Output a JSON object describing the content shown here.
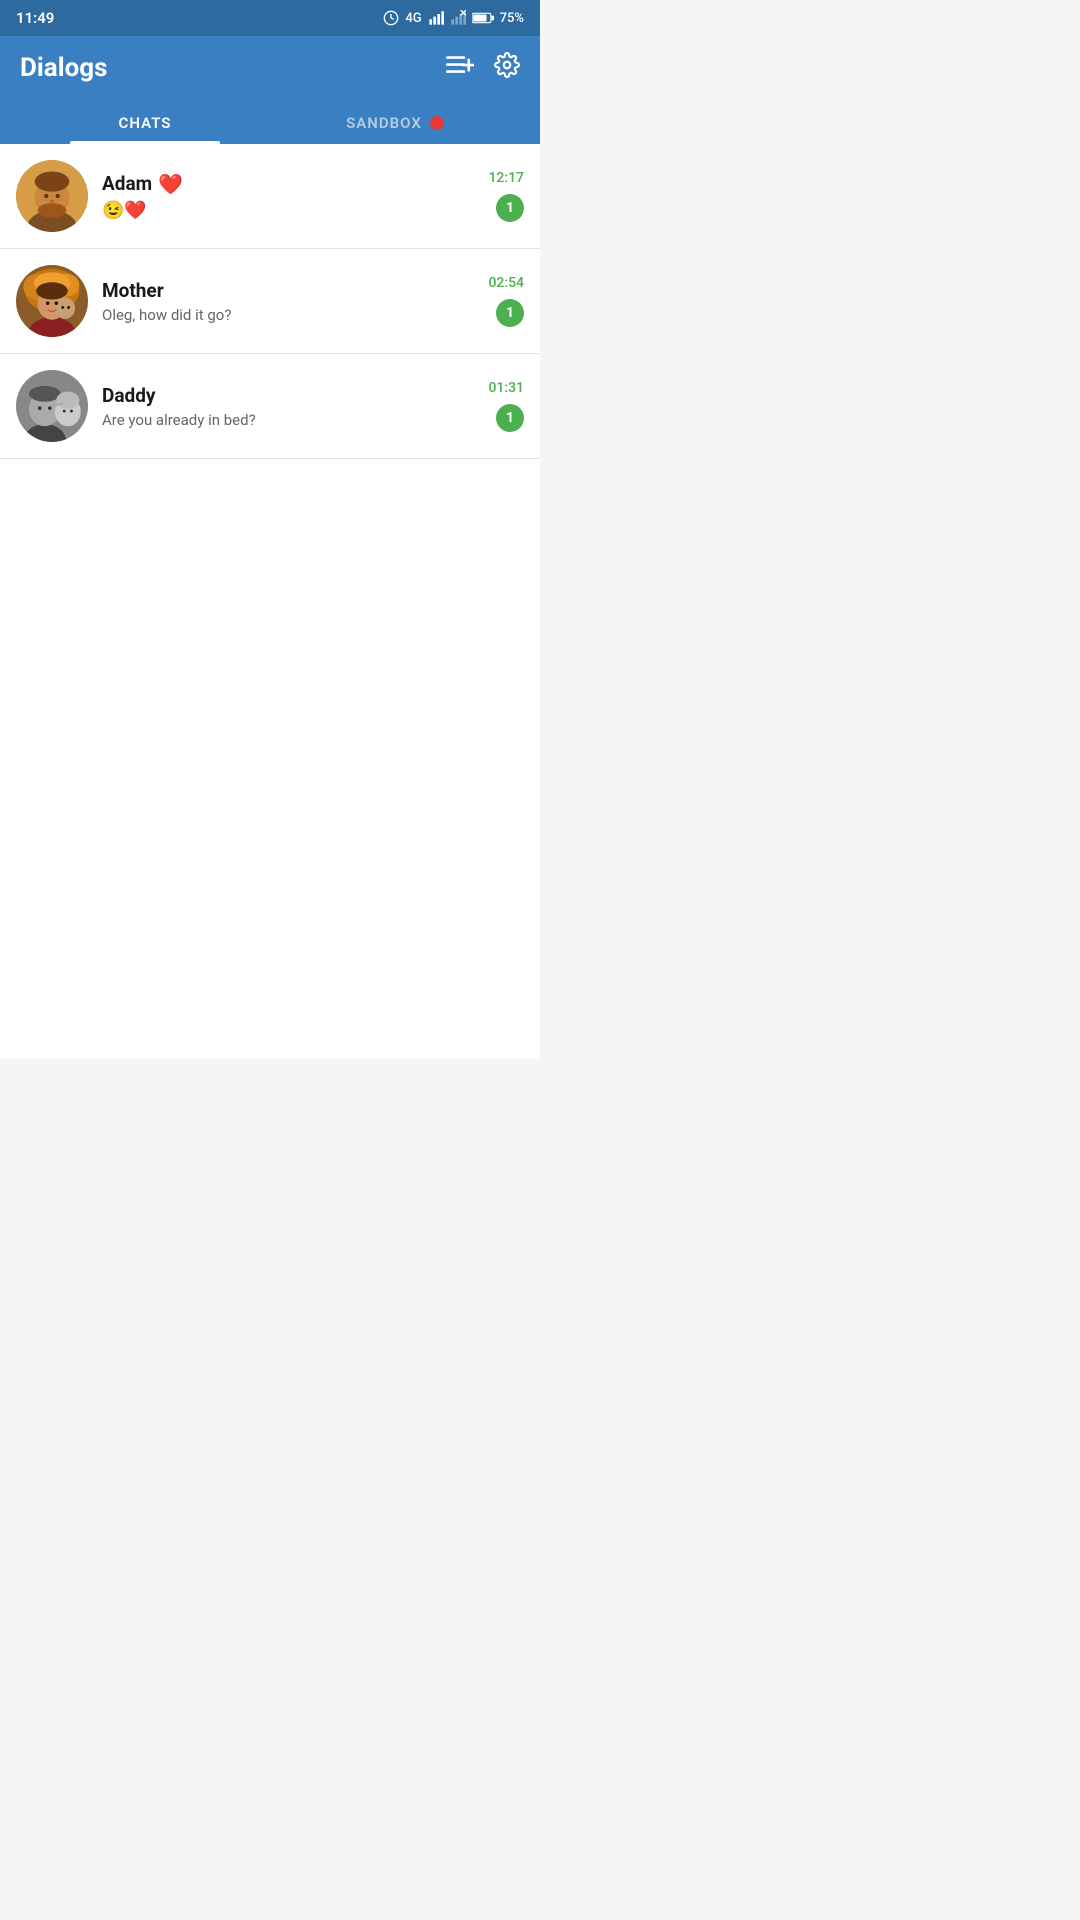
{
  "statusBar": {
    "time": "11:49",
    "signal": "4G",
    "battery": "75%"
  },
  "header": {
    "title": "Dialogs",
    "newChatIcon": "≡+",
    "settingsIcon": "⚙"
  },
  "tabs": [
    {
      "id": "chats",
      "label": "CHATS",
      "active": true
    },
    {
      "id": "sandbox",
      "label": "SANDBOX",
      "active": false
    }
  ],
  "chats": [
    {
      "id": "adam",
      "name": "Adam",
      "nameEmoji": "❤️",
      "preview": "😉❤️",
      "time": "12:17",
      "badge": "1"
    },
    {
      "id": "mother",
      "name": "Mother",
      "preview": "Oleg, how did it go?",
      "time": "02:54",
      "badge": "1"
    },
    {
      "id": "daddy",
      "name": "Daddy",
      "preview": "Are you already in bed?",
      "time": "01:31",
      "badge": "1"
    }
  ],
  "colors": {
    "headerBg": "#3a7fc1",
    "statusBg": "#2d6a9f",
    "activeTab": "#ffffff",
    "inactiveTab": "rgba(255,255,255,0.6)",
    "badgeBg": "#4caf50",
    "timeColor": "#4caf50",
    "sandboxDot": "#e53935"
  }
}
